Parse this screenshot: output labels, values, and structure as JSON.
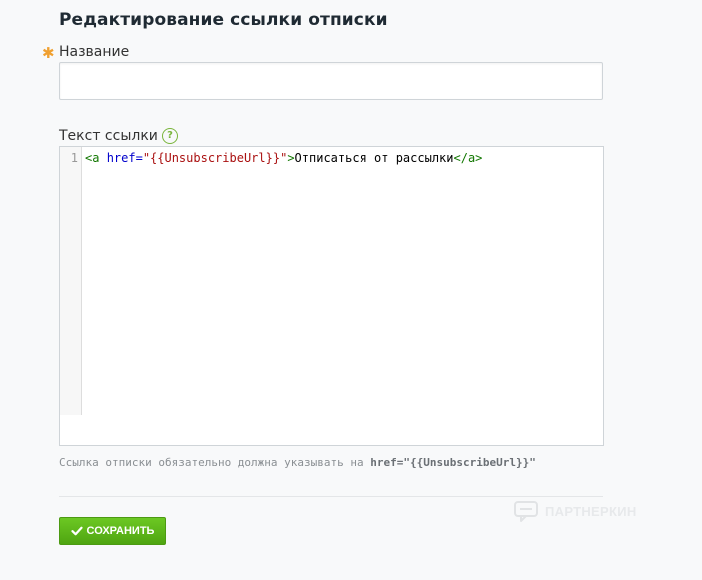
{
  "page": {
    "title": "Редактирование ссылки отписки"
  },
  "form": {
    "name": {
      "required_mark": "✱",
      "label": "Название",
      "value": "",
      "placeholder": ""
    },
    "link_text": {
      "label": "Текст ссылки",
      "help_icon": "?",
      "line_number": "1",
      "code": {
        "tag_open": "<a ",
        "attr_name": "href=",
        "attr_value": "\"{{UnsubscribeUrl}}\"",
        "tag_close": ">",
        "text": "Отписаться от рассылки",
        "end_tag": "</a>"
      }
    },
    "hint": {
      "text": "Ссылка отписки обязательно должна указывать на ",
      "code": "href=\"{{UnsubscribeUrl}}\""
    }
  },
  "actions": {
    "save_label": "СОХРАНИТЬ",
    "save_icon": "check-icon"
  },
  "watermark": {
    "text": "ПАРТНЕРКИН"
  },
  "colors": {
    "accent_green": "#5cb618",
    "required_star": "#f0a030",
    "help_icon": "#7ab53c"
  }
}
